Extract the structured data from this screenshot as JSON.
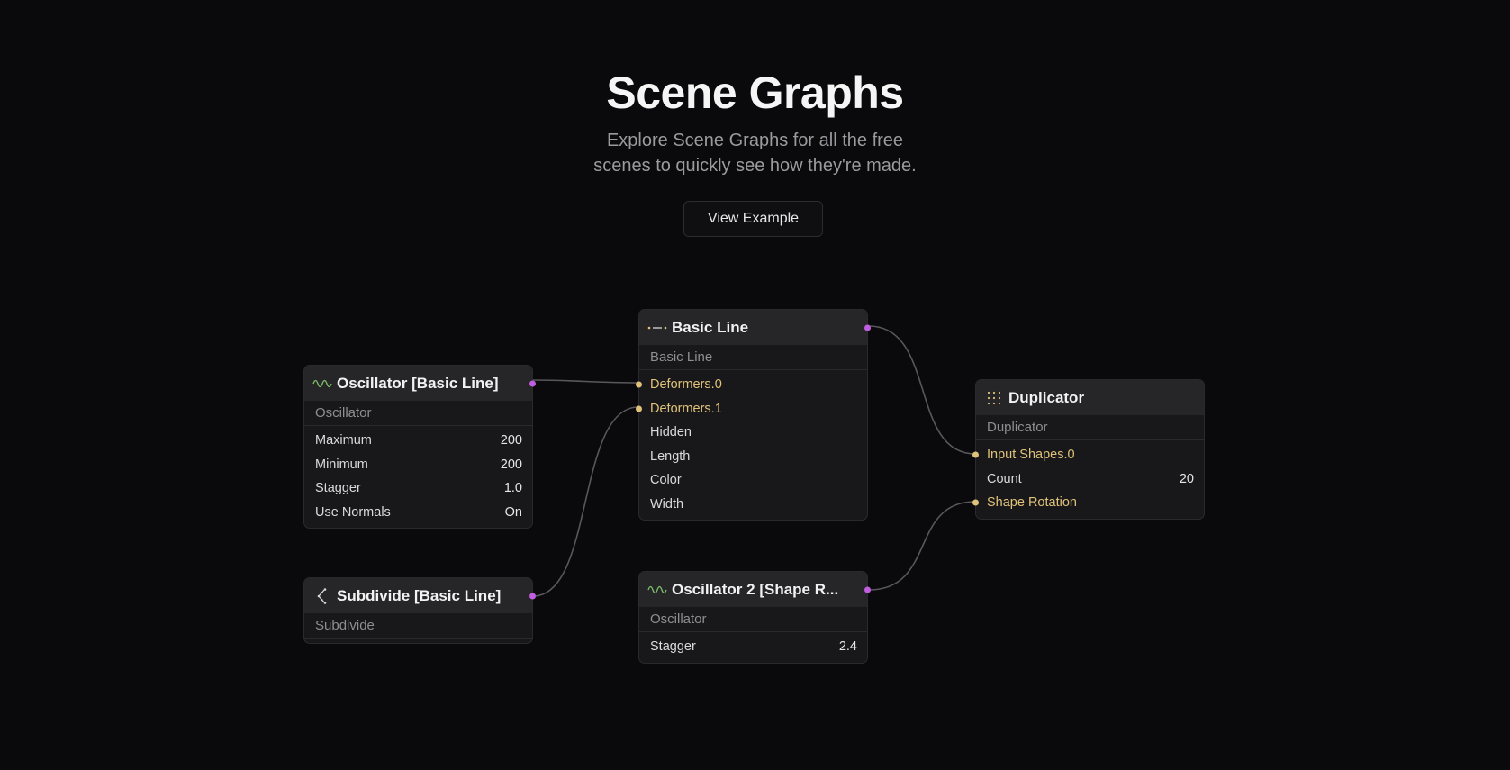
{
  "hero": {
    "title": "Scene Graphs",
    "subtitle_line1": "Explore Scene Graphs for all the free",
    "subtitle_line2": "scenes to quickly see how they're made.",
    "cta_label": "View Example"
  },
  "colors": {
    "output_port": "#c15ee0",
    "input_port": "#e0c27a",
    "oscillator_icon": "#7fbf6a",
    "wire": "#58585c"
  },
  "nodes": {
    "oscillator": {
      "icon": "sine-wave-icon",
      "title": "Oscillator [Basic Line]",
      "type": "Oscillator",
      "rows": [
        {
          "label": "Maximum",
          "value": "200"
        },
        {
          "label": "Minimum",
          "value": "200"
        },
        {
          "label": "Stagger",
          "value": "1.0"
        },
        {
          "label": "Use Normals",
          "value": "On"
        }
      ]
    },
    "subdivide": {
      "icon": "subdivide-icon",
      "title": "Subdivide [Basic Line]",
      "type": "Subdivide"
    },
    "basic_line": {
      "icon": "dashed-line-icon",
      "title": "Basic Line",
      "type": "Basic Line",
      "rows": [
        {
          "label": "Deformers.0"
        },
        {
          "label": "Deformers.1"
        },
        {
          "label": "Hidden"
        },
        {
          "label": "Length"
        },
        {
          "label": "Color"
        },
        {
          "label": "Width"
        }
      ]
    },
    "oscillator2": {
      "icon": "sine-wave-icon",
      "title": "Oscillator 2 [Shape R...",
      "type": "Oscillator",
      "rows": [
        {
          "label": "Stagger",
          "value": "2.4"
        }
      ]
    },
    "duplicator": {
      "icon": "dot-grid-icon",
      "title": "Duplicator",
      "type": "Duplicator",
      "rows": [
        {
          "label": "Input Shapes.0"
        },
        {
          "label": "Count",
          "value": "20"
        },
        {
          "label": "Shape Rotation"
        }
      ]
    }
  }
}
